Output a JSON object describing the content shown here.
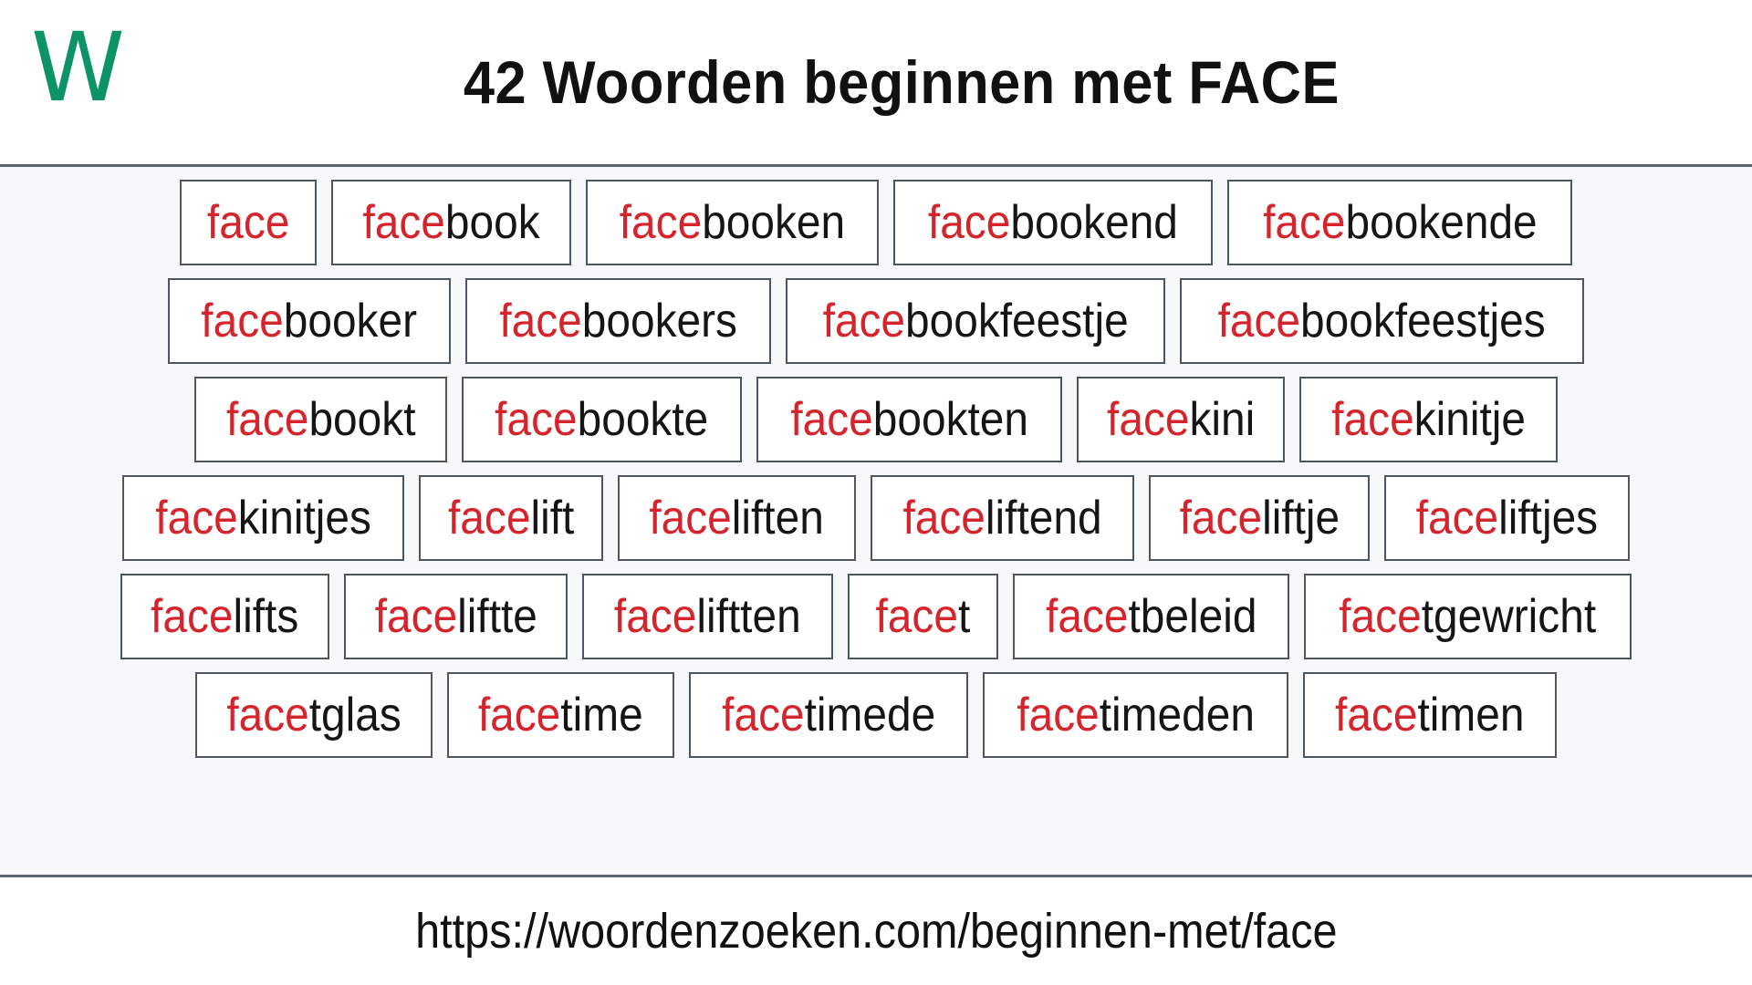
{
  "header": {
    "logo_letter": "W",
    "logo_color": "#0c9465",
    "title": "42 Woorden beginnen met FACE"
  },
  "colors": {
    "prefix_red": "#d5242c",
    "text_black": "#151515",
    "box_border": "#4c5763",
    "area_background": "#f6f8fa",
    "rule": "#5d6670",
    "brand_green": "#0c9465"
  },
  "word_list": {
    "prefix": "face",
    "total_count": 42,
    "rows": [
      [
        {
          "prefix": "face",
          "rest": ""
        },
        {
          "prefix": "face",
          "rest": "book"
        },
        {
          "prefix": "face",
          "rest": "booken"
        },
        {
          "prefix": "face",
          "rest": "bookend"
        },
        {
          "prefix": "face",
          "rest": "bookende"
        }
      ],
      [
        {
          "prefix": "face",
          "rest": "booker"
        },
        {
          "prefix": "face",
          "rest": "bookers"
        },
        {
          "prefix": "face",
          "rest": "bookfeestje"
        },
        {
          "prefix": "face",
          "rest": "bookfeestjes"
        }
      ],
      [
        {
          "prefix": "face",
          "rest": "bookt"
        },
        {
          "prefix": "face",
          "rest": "bookte"
        },
        {
          "prefix": "face",
          "rest": "bookten"
        },
        {
          "prefix": "face",
          "rest": "kini"
        },
        {
          "prefix": "face",
          "rest": "kinitje"
        }
      ],
      [
        {
          "prefix": "face",
          "rest": "kinitjes"
        },
        {
          "prefix": "face",
          "rest": "lift"
        },
        {
          "prefix": "face",
          "rest": "liften"
        },
        {
          "prefix": "face",
          "rest": "liftend"
        },
        {
          "prefix": "face",
          "rest": "liftje"
        },
        {
          "prefix": "face",
          "rest": "liftjes"
        }
      ],
      [
        {
          "prefix": "face",
          "rest": "lifts"
        },
        {
          "prefix": "face",
          "rest": "liftte"
        },
        {
          "prefix": "face",
          "rest": "liftten"
        },
        {
          "prefix": "face",
          "rest": "t"
        },
        {
          "prefix": "face",
          "rest": "tbeleid"
        },
        {
          "prefix": "face",
          "rest": "tgewricht"
        }
      ],
      [
        {
          "prefix": "face",
          "rest": "tglas"
        },
        {
          "prefix": "face",
          "rest": "time"
        },
        {
          "prefix": "face",
          "rest": "timede"
        },
        {
          "prefix": "face",
          "rest": "timeden"
        },
        {
          "prefix": "face",
          "rest": "timen"
        }
      ]
    ]
  },
  "footer": {
    "url": "https://woordenzoeken.com/beginnen-met/face"
  }
}
